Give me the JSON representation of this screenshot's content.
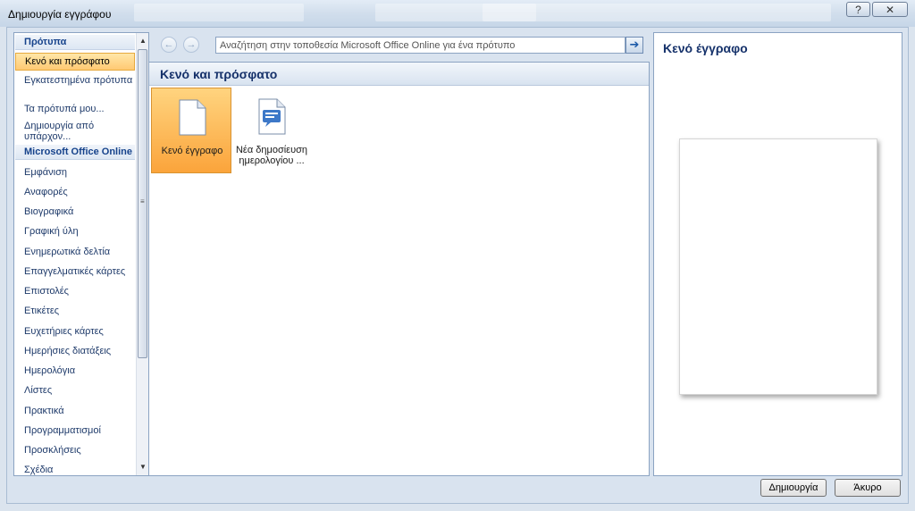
{
  "window": {
    "title": "Δημιουργία εγγράφου",
    "help_label": "?",
    "close_label": "✕"
  },
  "sidebar": {
    "header_templates": "Πρότυπα",
    "header_online": "Microsoft Office Online",
    "items": [
      {
        "label": "Κενό και πρόσφατο",
        "selected": true
      },
      {
        "label": "Εγκατεστημένα πρότυπα"
      },
      {
        "label": "Τα πρότυπά μου..."
      },
      {
        "label": "Δημιουργία από υπάρχον..."
      }
    ],
    "online_items": [
      {
        "label": "Εμφάνιση"
      },
      {
        "label": "Αναφορές"
      },
      {
        "label": "Βιογραφικά"
      },
      {
        "label": "Γραφική ύλη"
      },
      {
        "label": "Ενημερωτικά δελτία"
      },
      {
        "label": "Επαγγελματικές κάρτες"
      },
      {
        "label": "Επιστολές"
      },
      {
        "label": "Ετικέτες"
      },
      {
        "label": "Ευχετήριες κάρτες"
      },
      {
        "label": "Ημερήσιες διατάξεις"
      },
      {
        "label": "Ημερολόγια"
      },
      {
        "label": "Λίστες"
      },
      {
        "label": "Πρακτικά"
      },
      {
        "label": "Προγραμματισμοί"
      },
      {
        "label": "Προσκλήσεις"
      },
      {
        "label": "Σχέδια"
      }
    ]
  },
  "search": {
    "placeholder": "Αναζήτηση στην τοποθεσία Microsoft Office Online για ένα πρότυπο"
  },
  "main": {
    "section_title": "Κενό και πρόσφατο",
    "tiles": [
      {
        "label": "Κενό έγγραφο",
        "icon": "blank-document-icon",
        "selected": true
      },
      {
        "label_line1": "Νέα δημοσίευση",
        "label_line2": "ημερολογίου ...",
        "icon": "blog-post-icon"
      }
    ]
  },
  "preview": {
    "title": "Κενό έγγραφο"
  },
  "buttons": {
    "create": "Δημιουργία",
    "cancel": "Άκυρο"
  },
  "colors": {
    "accent": "#15316a",
    "selection": "#fbb040"
  }
}
